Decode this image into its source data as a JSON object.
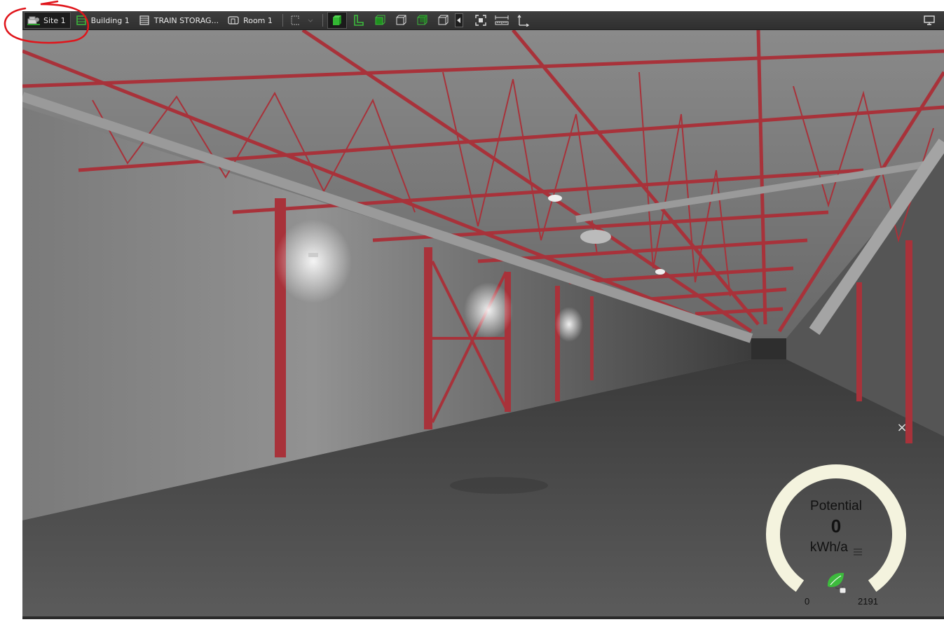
{
  "breadcrumbs": [
    {
      "label": "Site 1",
      "icon": "site-icon",
      "active": true
    },
    {
      "label": "Building 1",
      "icon": "building-icon",
      "active": false
    },
    {
      "label": "TRAIN STORAG...",
      "icon": "storey-icon",
      "active": false
    },
    {
      "label": "Room 1",
      "icon": "room-icon",
      "active": false
    }
  ],
  "toolbar_icons": [
    "floorplan-icon",
    "solid-view-icon",
    "l-shape-icon",
    "box-front-icon",
    "box-side-icon",
    "box-back-icon",
    "box-outline-icon",
    "collapse-arrow-icon",
    "fit-view-icon",
    "measure-icon",
    "axis-icon",
    "monitor-icon"
  ],
  "gauge": {
    "title": "Potential",
    "value": "0",
    "unit": "kWh/a",
    "min": "0",
    "max": "2191",
    "fraction": 0,
    "menu_icon": "menu-icon",
    "leaf_icon": "eco-plug-icon"
  },
  "close_symbol": "×",
  "colors": {
    "truss": "#a8323a",
    "wall": "#8a8a8a",
    "floor": "#4a4a4a",
    "ceiling": "#6f6f6f",
    "gauge_ring": "#f4f3de",
    "accent_green": "#3dbb3d",
    "annotation": "#e0151b"
  }
}
